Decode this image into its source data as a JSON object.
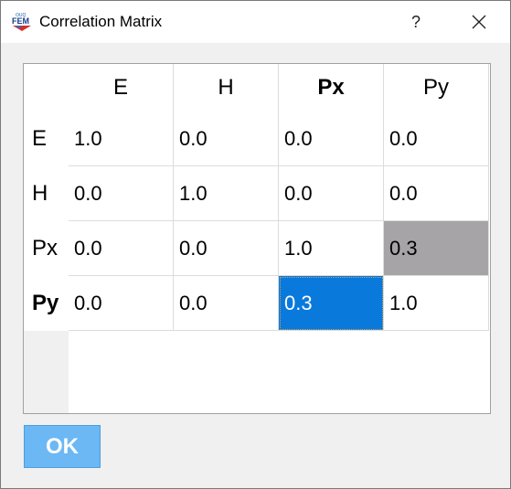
{
  "window": {
    "title": "Correlation Matrix",
    "icon_label_top": "OUQ",
    "icon_label": "FEM",
    "help_label": "?",
    "close_icon": "close-icon"
  },
  "matrix": {
    "columns": [
      "E",
      "H",
      "Px",
      "Py"
    ],
    "rows": [
      {
        "label": "E",
        "values": [
          "1.0",
          "0.0",
          "0.0",
          "0.0"
        ]
      },
      {
        "label": "H",
        "values": [
          "0.0",
          "1.0",
          "0.0",
          "0.0"
        ]
      },
      {
        "label": "Px",
        "values": [
          "0.0",
          "0.0",
          "1.0",
          "0.3"
        ]
      },
      {
        "label": "Py",
        "values": [
          "0.0",
          "0.0",
          "0.3",
          "1.0"
        ]
      }
    ],
    "bold_headers": [
      "Px",
      "Py"
    ],
    "highlighted_cell_color": "#a6a4a6",
    "selected_cell_color": "#0a79dc"
  },
  "footer": {
    "ok_label": "OK",
    "ok_color": "#6cb8f4"
  }
}
